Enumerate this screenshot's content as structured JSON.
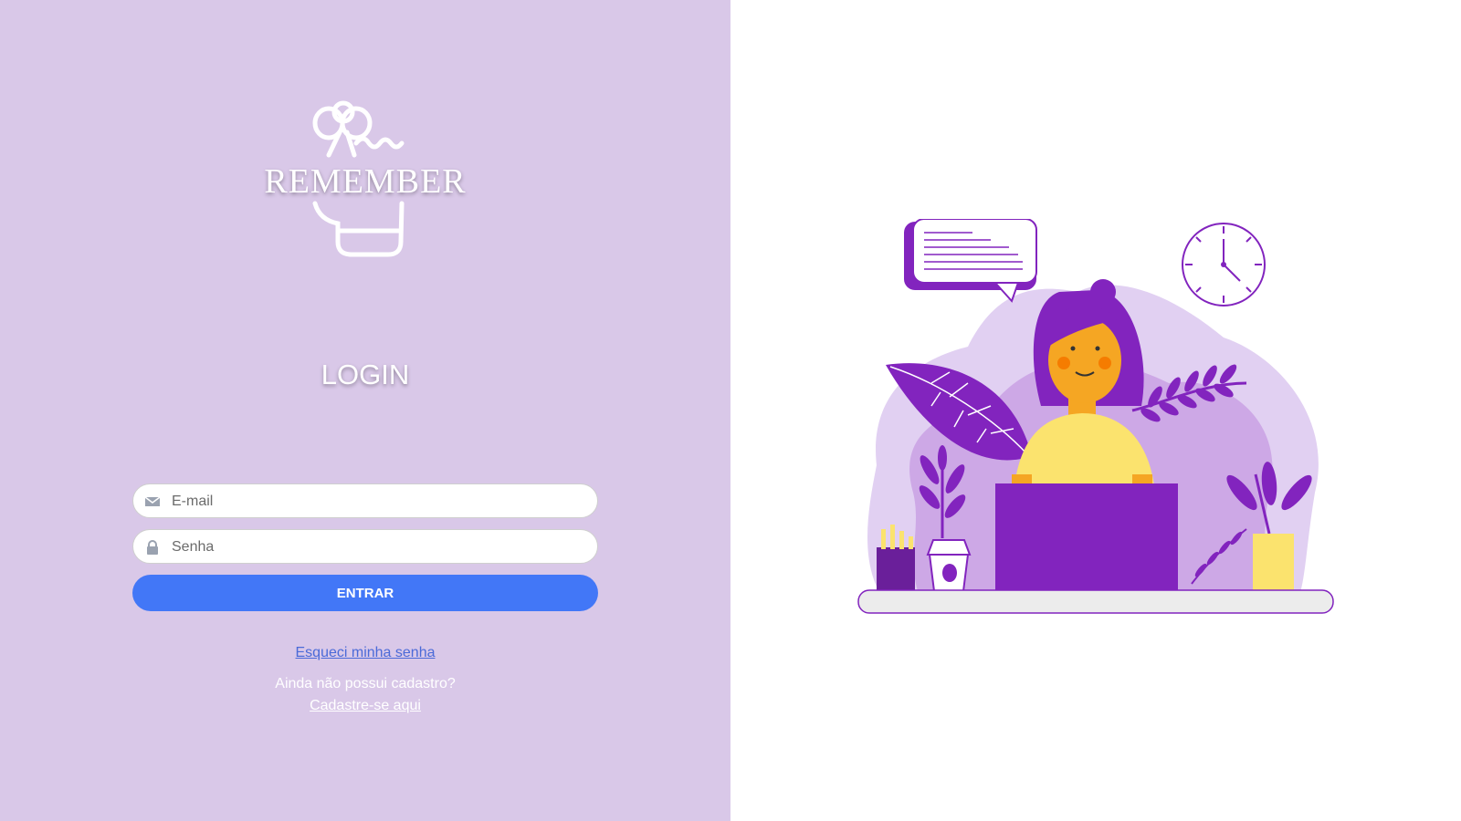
{
  "brand": {
    "name": "REMEMBER"
  },
  "login": {
    "title": "LOGIN",
    "email_placeholder": "E-mail",
    "password_placeholder": "Senha",
    "submit_label": "ENTRAR",
    "forgot_label": "Esqueci minha senha",
    "no_account_text": "Ainda não possui cadastro?",
    "register_label": "Cadastre-se aqui"
  },
  "colors": {
    "left_bg": "#d9c8e8",
    "button": "#4277f7",
    "purple": "#8224be",
    "yellow": "#fbe36e"
  },
  "icons": {
    "email": "envelope-icon",
    "password": "lock-icon"
  }
}
